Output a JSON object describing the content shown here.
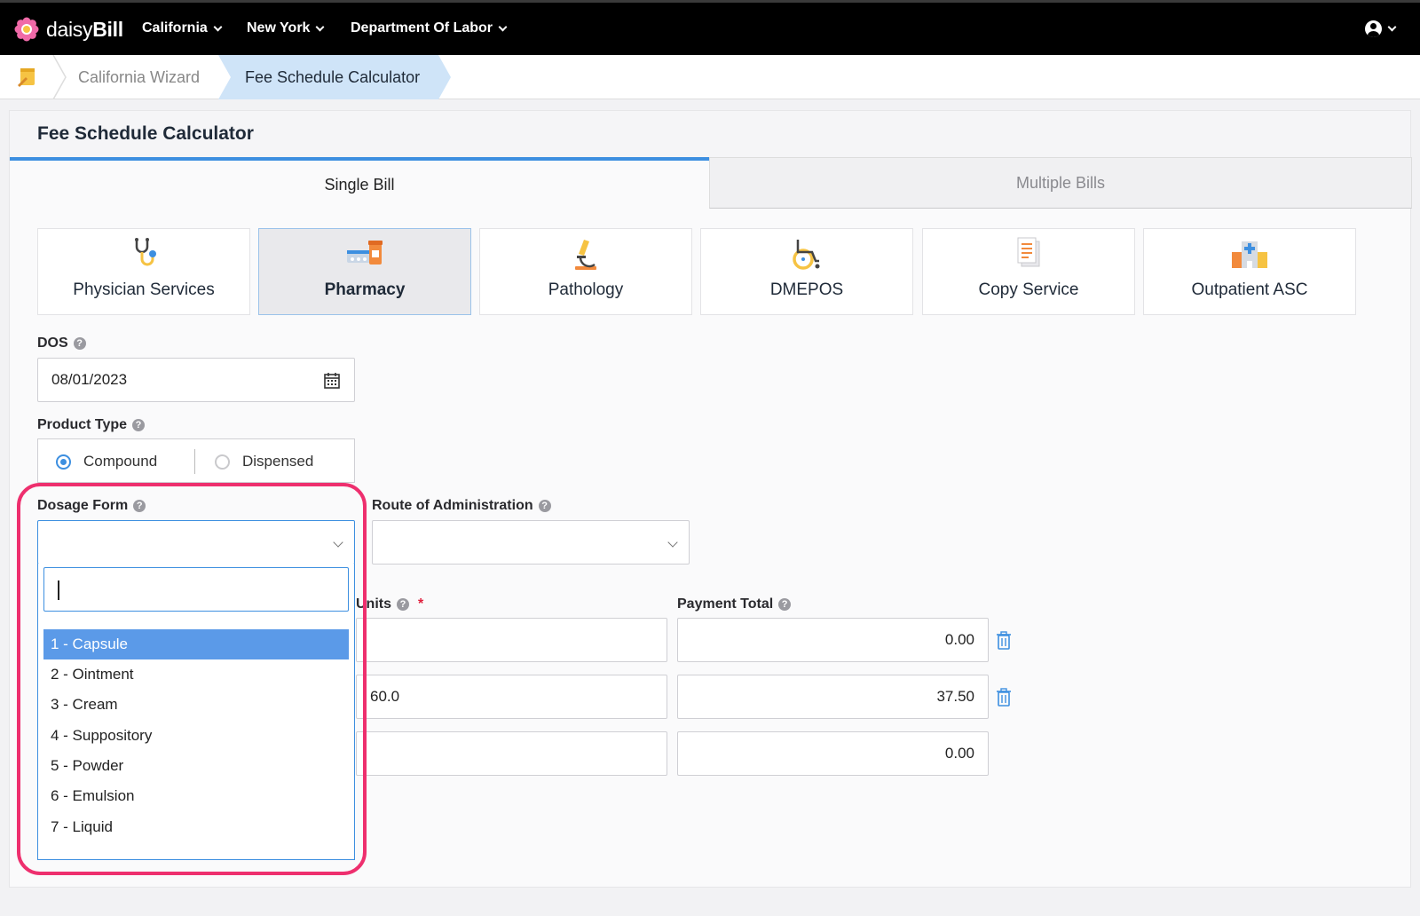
{
  "app": {
    "logo_text_light": "daisy",
    "logo_text_bold": "Bill",
    "nav": [
      "California",
      "New York",
      "Department Of Labor"
    ]
  },
  "breadcrumb": {
    "items": [
      "California Wizard",
      "Fee Schedule Calculator"
    ]
  },
  "page": {
    "title": "Fee Schedule Calculator",
    "tabs": [
      "Single Bill",
      "Multiple Bills"
    ],
    "active_tab": "Single Bill"
  },
  "services": [
    {
      "label": "Physician Services",
      "icon": "stethoscope-icon"
    },
    {
      "label": "Pharmacy",
      "icon": "pharmacy-icon",
      "selected": true
    },
    {
      "label": "Pathology",
      "icon": "microscope-icon"
    },
    {
      "label": "DMEPOS",
      "icon": "wheelchair-icon"
    },
    {
      "label": "Copy Service",
      "icon": "document-icon"
    },
    {
      "label": "Outpatient ASC",
      "icon": "hospital-icon"
    }
  ],
  "form": {
    "dos_label": "DOS",
    "dos_value": "08/01/2023",
    "product_type_label": "Product Type",
    "product_types": [
      "Compound",
      "Dispensed"
    ],
    "product_type_selected": "Compound",
    "dosage_form_label": "Dosage Form",
    "dosage_form_value": "",
    "route_label": "Route of Administration",
    "route_value": "",
    "units_label": "Units",
    "payment_total_label": "Payment Total",
    "help_glyph": "?",
    "required_mark": "*"
  },
  "rows": [
    {
      "units": "",
      "payment": "0.00"
    },
    {
      "units": "60.0",
      "payment": "37.50"
    },
    {
      "units": "",
      "payment": "0.00"
    }
  ],
  "dosage_dropdown": {
    "search_value": "",
    "options": [
      "1 - Capsule",
      "2 - Ointment",
      "3 - Cream",
      "4 - Suppository",
      "5 - Powder",
      "6 - Emulsion",
      "7 - Liquid"
    ],
    "highlighted": "1 - Capsule"
  },
  "colors": {
    "accent": "#3d8fe0",
    "highlight_ring": "#ee2f6e",
    "topbar": "#000000",
    "active_crumb": "#cfe4f8"
  }
}
